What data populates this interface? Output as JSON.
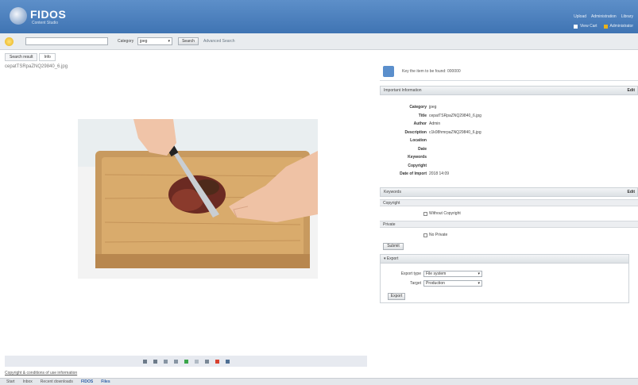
{
  "header": {
    "logo_text": "FIDOS",
    "logo_sub": "Content Studio",
    "links": [
      "Upload",
      "Administration",
      "Library"
    ],
    "user_items": [
      "View Cart",
      "Administrator"
    ]
  },
  "search": {
    "placeholder": "",
    "category_label": "Category",
    "category_value": "jpeg",
    "button": "Search",
    "advanced": "Advanced Search"
  },
  "tabs": [
    {
      "label": "Search result"
    },
    {
      "label": "Info"
    }
  ],
  "file": {
    "name": "cepatTSRpaZNQ29840_6.jpg"
  },
  "toolbar": {
    "icons": [
      "zoom-in-icon",
      "zoom-out-icon",
      "fit-icon",
      "rotate-left-icon",
      "rotate-right-icon",
      "crop-icon",
      "info-icon",
      "delete-icon",
      "print-icon"
    ]
  },
  "status_link": "Copyright & conditions of use information",
  "footer": {
    "items": [
      "Start",
      "Inbox",
      "Recent downloads",
      "FIDOS",
      "Files"
    ]
  },
  "info": {
    "text": "Key the item to be found: 000000"
  },
  "properties": {
    "title": "Important Information",
    "edit": "Edit",
    "rows": [
      {
        "label": "Category",
        "value": "jpeg"
      },
      {
        "label": "Title",
        "value": "cepatTSRpaZNQ29840_6.jpg"
      },
      {
        "label": "Author",
        "value": "Admin"
      },
      {
        "label": "Description",
        "value": "c1k08hmrpaZNQ29840_6.jpg"
      },
      {
        "label": "Location",
        "value": ""
      },
      {
        "label": "Date",
        "value": ""
      },
      {
        "label": "Keywords",
        "value": ""
      },
      {
        "label": "Copyright",
        "value": ""
      },
      {
        "label": "Date of Import",
        "value": "2018 14:09"
      }
    ]
  },
  "keywords": {
    "title": "Keywords",
    "edit": "Edit",
    "copyright_label": "Copyright",
    "copyright_check": "Without Copyright",
    "private_label": "Private",
    "private_check": "No Private",
    "submit": "Submit"
  },
  "export": {
    "title": "Export",
    "type_label": "Export type",
    "type_value": "File system",
    "target_label": "Target",
    "target_value": "Production",
    "button": "Export"
  },
  "colors": {
    "header": "#4a7fbe",
    "accent": "#5b8fcc"
  }
}
